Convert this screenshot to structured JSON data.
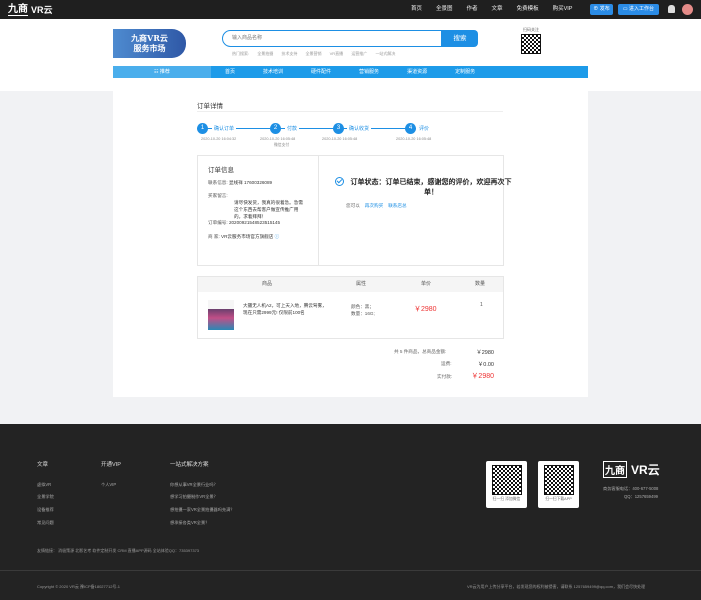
{
  "topbar": {
    "logo_mark": "九商",
    "logo_text": "VR云",
    "nav": [
      "首页",
      "全景图",
      "作者",
      "文章",
      "免费模板",
      "购买VIP"
    ],
    "publish": "发布",
    "workspace": "进入工作台"
  },
  "header": {
    "brand_line1": "九商VR云",
    "brand_line2": "服务市场",
    "search_placeholder": "输入商品名称",
    "search_button": "搜索",
    "hot_label": "热门搜索:",
    "hot": [
      "全景拍摄",
      "技术支持",
      "全景营销",
      "VR直播",
      "运营推广",
      "一站式解决"
    ],
    "qr_label": "扫码关注"
  },
  "mainnav": {
    "category": "推荐",
    "items": [
      "首页",
      "技术培训",
      "硬件配件",
      "营销服务",
      "渠道资源",
      "定制服务"
    ]
  },
  "order": {
    "title": "订单详情",
    "steps": [
      {
        "num": "1",
        "label": "确认订单",
        "date": "2020-10-20 16:04:32",
        "sub": ""
      },
      {
        "num": "2",
        "label": "付款",
        "date": "2020-10-20 16:05:48",
        "sub": "微信支付"
      },
      {
        "num": "3",
        "label": "确认收货",
        "date": "2020-10-20 16:05:48",
        "sub": ""
      },
      {
        "num": "4",
        "label": "评价",
        "date": "2020-10-20 16:05:48",
        "sub": ""
      }
    ],
    "info_title": "订单信息",
    "contact_label": "联系信息:",
    "contact_value": "显线祥    17600326089",
    "note_label": "买家留言:",
    "note_value": "请尽快发货，我真的很着急。急需这个东西去帮客户做宣传推广用的。求着拜拜！",
    "order_no_label": "订单编号:",
    "order_no_value": "20200921548523515145",
    "shop_label": "商    家:",
    "shop_value": "VR云服务市场官方旗舰店",
    "status": "订单状态：订单已结束，感谢您的评价，欢迎再次下单！",
    "ops_label": "您可以",
    "ops": [
      "再次购买",
      "联系店总"
    ]
  },
  "table": {
    "headers": [
      "商品",
      "属性",
      "单价",
      "数量"
    ],
    "product_text": "大疆无人机A2，可上天入地，腾云驾雾，现在只需2999元! 仅限前100名",
    "attr_color": "颜色：黑；",
    "attr_qty": "数量：16G;",
    "price": "￥2980",
    "qty": "1"
  },
  "summary": {
    "count_label": "共 5 件商品，总商品金额:",
    "count_value": "￥2980",
    "shipping_label": "运费:",
    "shipping_value": "￥0.00",
    "paid_label": "实付款:",
    "paid_value": "￥2980"
  },
  "footer": {
    "cols": [
      {
        "title": "文章",
        "items": [
          "虚拟VR",
          "全景学院",
          "设备推荐",
          "常见问题"
        ]
      },
      {
        "title": "开通VIP",
        "items": [
          "个人VIP"
        ]
      },
      {
        "title": "一站式解决方案",
        "items": [
          "你想从事VR全景行业吗？",
          "想学习拍摄制作VR全景？",
          "想拍摄一家VR全景拍摄器吗充满？",
          "想承接各类VR全景？"
        ]
      }
    ],
    "qr1": "扫一扫 添加微信",
    "qr2": "扫一扫下载APP",
    "logo_mark": "九商",
    "logo_text": "VR云",
    "hotline": "商务客服电话：400-677-5008",
    "qq": "QQ：1257659499",
    "links": "友情链接：   消极策源    北影艺考    软件定制开发    CRM    直播APP源码    全站体验QQ：735397373",
    "copyright": "Copyright © 2020 VR云 豫ICP备18027712号-1",
    "right_info": "VR云为用户上传分享平台，若发现您的权利被侵害，请联系 1257659499@qq.com，我们会尽快处理"
  }
}
